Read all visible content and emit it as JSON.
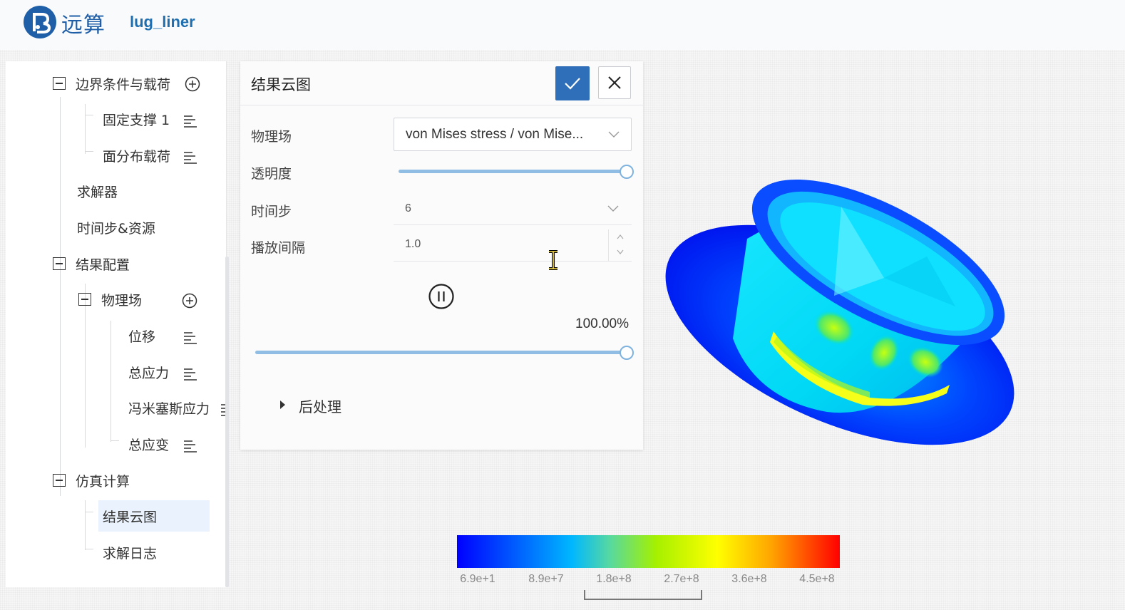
{
  "header": {
    "logo_text": "远算",
    "project_name": "lug_liner"
  },
  "tree": {
    "items": [
      {
        "label": "边界条件与载荷"
      },
      {
        "label": "固定支撑 1"
      },
      {
        "label": "面分布载荷"
      },
      {
        "label": "求解器"
      },
      {
        "label": "时间步&资源"
      },
      {
        "label": "结果配置"
      },
      {
        "label": "物理场"
      },
      {
        "label": "位移"
      },
      {
        "label": "总应力"
      },
      {
        "label": "冯米塞斯应力"
      },
      {
        "label": "总应变"
      },
      {
        "label": "仿真计算"
      },
      {
        "label": "结果云图"
      },
      {
        "label": "求解日志"
      }
    ]
  },
  "dialog": {
    "title": "结果云图",
    "field_label": "物理场",
    "field_value": "von Mises stress / von Mise...",
    "opacity_label": "透明度",
    "opacity_value": 1.0,
    "timestep_label": "时间步",
    "timestep_value": "6",
    "interval_label": "播放间隔",
    "interval_value": "1.0",
    "progress_text": "100.00%",
    "progress_value": 1.0,
    "post_label": "后处理"
  },
  "legend": {
    "ticks": [
      "6.9e+1",
      "8.9e+7",
      "1.8e+8",
      "2.7e+8",
      "3.6e+8",
      "4.5e+8"
    ],
    "colors": [
      "#0000ff",
      "#00b7ff",
      "#a5f000",
      "#ffff00",
      "#ffa500",
      "#ff0000"
    ]
  },
  "colors": {
    "accent": "#2f6eb8",
    "slider": "#8fbde3",
    "selected_bg": "#eaf3fd"
  }
}
